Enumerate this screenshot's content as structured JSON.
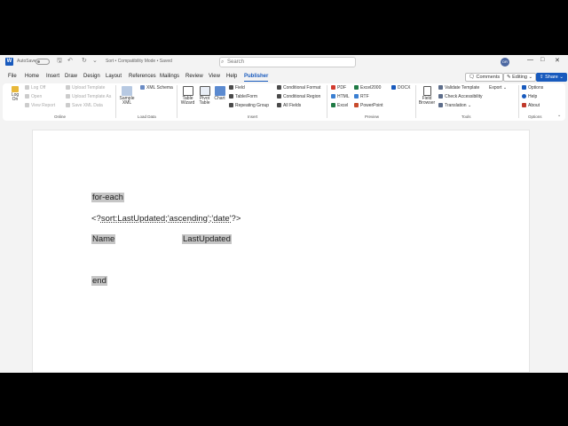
{
  "titlebar": {
    "autosave": "AutoSave",
    "autosave_state": "Off",
    "doc_title": "Sort  •  Compatibility Mode  •  Saved",
    "search_placeholder": "Search",
    "avatar_initials": "DR"
  },
  "menu": {
    "items": [
      "File",
      "Home",
      "Insert",
      "Draw",
      "Design",
      "Layout",
      "References",
      "Mailings",
      "Review",
      "View",
      "Help",
      "Publisher"
    ],
    "active": "Publisher",
    "comments": "Comments",
    "editing": "Editing",
    "share": "Share"
  },
  "ribbon": {
    "online": {
      "label": "Online",
      "log_on": "Log On",
      "log_off": "Log Off",
      "open": "Open",
      "view_report": "View Report",
      "upload_template": "Upload Template",
      "upload_template_as": "Upload Template As",
      "save_xml_data": "Save XML Data"
    },
    "load_data": {
      "label": "Load Data",
      "sample_xml": "Sample XML",
      "xml_schema": "XML Schema"
    },
    "insert": {
      "label": "Insert",
      "table_wizard": "Table Wizard",
      "pivot_table": "Pivot Table",
      "chart": "Chart",
      "field": "Field",
      "table_form": "Table/Form",
      "repeating_group": "Repeating Group",
      "conditional_format": "Conditional Format",
      "conditional_region": "Conditional Region",
      "all_fields": "All Fields"
    },
    "preview": {
      "label": "Preview",
      "pdf": "PDF",
      "html": "HTML",
      "excel": "Excel",
      "excel2000": "Excel2000",
      "rtf": "RTF",
      "powerpoint": "PowerPoint",
      "docx": "DOCX"
    },
    "tools": {
      "label": "Tools",
      "field_browser": "Field Browser",
      "validate_template": "Validate Template",
      "check_accessibility": "Check Accessibility",
      "translation": "Translation",
      "export": "Export"
    },
    "options": {
      "label": "Options",
      "options": "Options",
      "help": "Help",
      "about": "About"
    }
  },
  "document": {
    "for_each": "for-each",
    "sort_prefix": "<?",
    "sort_body": "sort:LastUpdated;'ascending';'date'",
    "sort_suffix": "?>",
    "col_name": "Name",
    "col_last_updated": "LastUpdated",
    "end": "end"
  },
  "colors": {
    "accent": "#185abd",
    "field_shading": "#c6c6c6",
    "ribbon_bg": "#ffffff",
    "app_bg": "#f3f3f3"
  }
}
